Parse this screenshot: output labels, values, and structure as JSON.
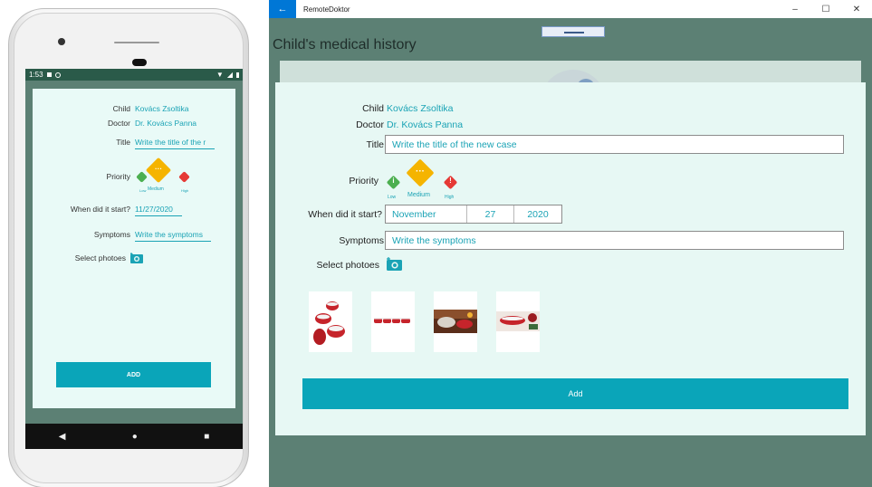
{
  "phone": {
    "status": {
      "time": "1:53"
    },
    "child_label": "Child",
    "child_value": "Kovács Zsoltika",
    "doctor_label": "Doctor",
    "doctor_value": "Dr. Kovács Panna",
    "title_label": "Title",
    "title_placeholder": "Write the title of the r",
    "priority_label": "Priority",
    "priority_options": [
      "Low",
      "Medium",
      "High"
    ],
    "when_label": "When did it start?",
    "when_value": "11/27/2020",
    "symptoms_label": "Symptoms",
    "symptoms_placeholder": "Write the symptoms",
    "photos_label": "Select photoes",
    "add_label": "ADD",
    "nav": {
      "back": "◀",
      "home": "●",
      "recents": "■"
    }
  },
  "desktop": {
    "app_title": "RemoteDoktor",
    "back_glyph": "←",
    "window_controls": {
      "minimize": "–",
      "maximize": "☐",
      "close": "✕"
    },
    "page_title": "Child's medical history",
    "child_label": "Child",
    "child_value": "Kovács Zsoltika",
    "doctor_label": "Doctor",
    "doctor_value": "Dr. Kovács Panna",
    "title_label": "Title",
    "title_placeholder": "Write the title of the new case",
    "priority_label": "Priority",
    "priority_options": [
      "Low",
      "Medium",
      "High"
    ],
    "when_label": "When did it start?",
    "date": {
      "month": "November",
      "day": "27",
      "year": "2020"
    },
    "symptoms_label": "Symptoms",
    "symptoms_placeholder": "Write the symptoms",
    "photos_label": "Select photoes",
    "add_label": "Add"
  },
  "colors": {
    "accent": "#0aa5b9",
    "link": "#1aa3b5",
    "background": "#5c8074",
    "card": "#e7f8f4",
    "priority_low": "#4caf50",
    "priority_medium": "#f5b400",
    "priority_high": "#e53935"
  },
  "icons": [
    "camera-icon",
    "back-arrow-icon",
    "info-icon",
    "more-icon",
    "alert-icon"
  ]
}
